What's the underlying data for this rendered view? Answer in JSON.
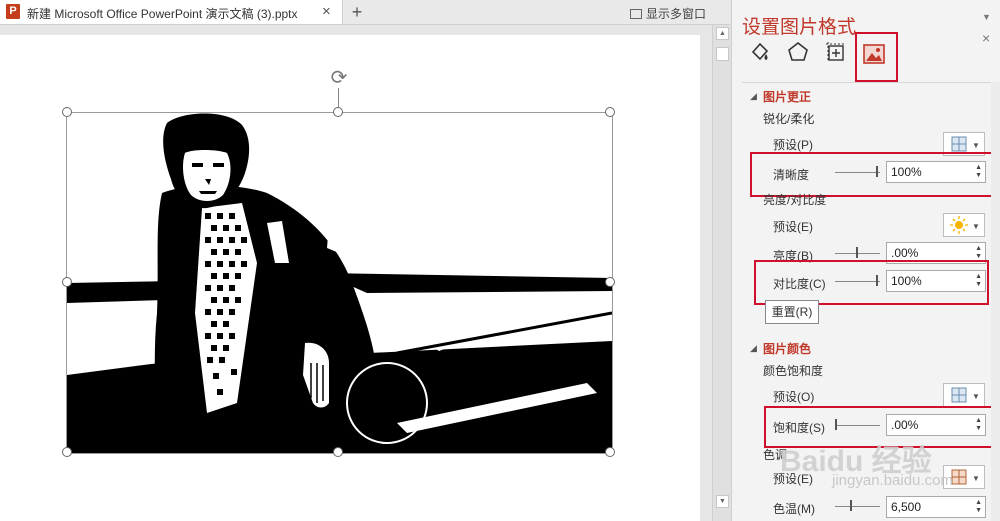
{
  "tab": {
    "title": "新建 Microsoft Office PowerPoint 演示文稿 (3).pptx",
    "icon_letter": "P",
    "close": "×",
    "new_tab": "+"
  },
  "window": {
    "multi_window_label": "显示多窗口"
  },
  "pane": {
    "title": "设置图片格式",
    "pin_glyph": "▼",
    "close_glyph": "×",
    "tabs": [
      "fill-line-icon",
      "effects-icon",
      "size-properties-icon",
      "picture-icon"
    ],
    "sections": {
      "correction": {
        "header": "图片更正",
        "sharpen_soften": "锐化/柔化",
        "preset_label_1": "预设(P)",
        "sharpness_label": "清晰度",
        "sharpness_value": "100%",
        "brightness_contrast": "亮度/对比度",
        "preset_label_2": "预设(E)",
        "brightness_label": "亮度(B)",
        "brightness_value": ".00%",
        "contrast_label": "对比度(C)",
        "contrast_value": "100%",
        "reset_label": "重置(R)"
      },
      "color": {
        "header": "图片颜色",
        "saturation_group": "颜色饱和度",
        "preset_label_3": "预设(O)",
        "saturation_label": "饱和度(S)",
        "saturation_value": ".00%",
        "tone_group": "色调",
        "preset_label_4": "预设(E)",
        "temperature_label": "色温(M)",
        "temperature_value": "6,500"
      }
    }
  },
  "watermark": {
    "text": "Baidu 经验",
    "sub": "jingyan.baidu.com"
  },
  "colors": {
    "accent": "#c0392b",
    "highlight_box": "#d0102a",
    "ppt_icon": "#c43e1c"
  }
}
